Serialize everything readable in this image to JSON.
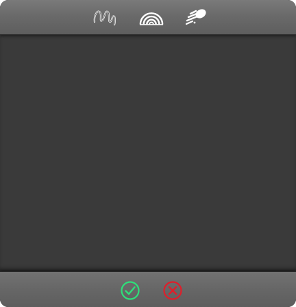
{
  "toolbar": {
    "tools": [
      {
        "icon": "squiggle-brush-icon"
      },
      {
        "icon": "rainbow-brush-icon"
      },
      {
        "icon": "comet-brush-icon"
      }
    ]
  },
  "footer": {
    "confirm": {
      "icon": "check-circle-icon",
      "color": "#2ee07a"
    },
    "cancel": {
      "icon": "x-circle-icon",
      "color": "#e01e2a"
    }
  },
  "colors": {
    "canvas": "#3a3a3a",
    "bar": "#6a6a6a",
    "icon": "#ffffff"
  }
}
